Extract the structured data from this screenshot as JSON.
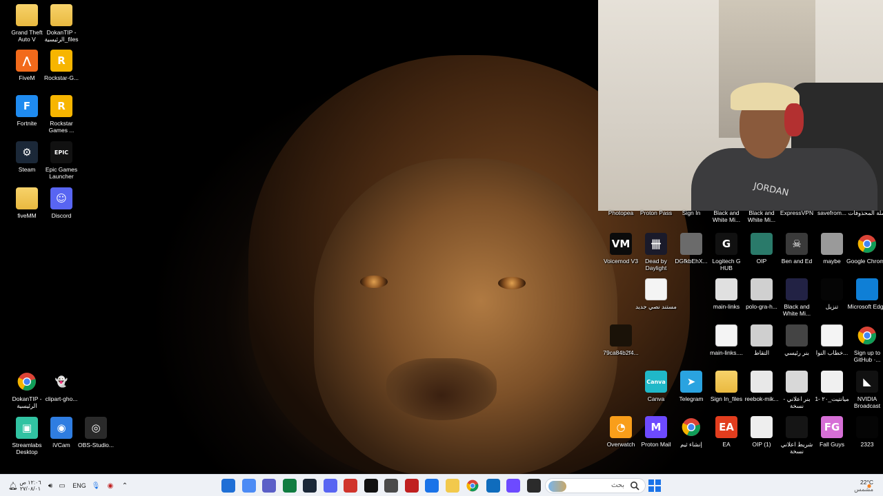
{
  "desktop_left_icons": [
    {
      "label": "Grand Theft Auto V",
      "icon": "folder-icon",
      "color": "#f2c94c"
    },
    {
      "label": "DokanTIP - الرئيسية_files",
      "icon": "folder-icon",
      "color": "#f2c94c"
    },
    {
      "label": "FiveM",
      "icon": "fivem-icon",
      "color": "#f26a1b",
      "glyph": "⋀"
    },
    {
      "label": "Rockstar-G...",
      "icon": "rockstar-icon",
      "color": "#f7b500",
      "glyph": "R"
    },
    {
      "label": "Fortnite",
      "icon": "fortnite-icon",
      "color": "#1f8bf0",
      "glyph": "F"
    },
    {
      "label": "Rockstar Games ...",
      "icon": "rockstar-icon",
      "color": "#f7b500",
      "glyph": "R"
    },
    {
      "label": "Steam",
      "icon": "steam-icon",
      "color": "#1b2838",
      "glyph": "⚙"
    },
    {
      "label": "Epic Games Launcher",
      "icon": "epic-games-icon",
      "color": "#111111",
      "glyph": "EPIC"
    },
    {
      "label": "fiveMM",
      "icon": "folder-icon",
      "color": "#f2c94c"
    },
    {
      "label": "Discord",
      "icon": "discord-icon",
      "color": "#5865f2",
      "glyph": "☺"
    },
    {
      "label": "DokanTIP - الرئيسية",
      "icon": "chrome-icon",
      "color": "#ffffff"
    },
    {
      "label": "clipart-gho...",
      "icon": "ghost-icon",
      "color": "#000000",
      "glyph": "👻"
    },
    {
      "label": "Streamlabs Desktop",
      "icon": "streamlabs-icon",
      "color": "#31c3a2",
      "glyph": "▣"
    },
    {
      "label": "iVCam",
      "icon": "ivcam-icon",
      "color": "#2f7de1",
      "glyph": "◉"
    },
    {
      "label": "OBS-Studio...",
      "icon": "obs-icon",
      "color": "#2a2a2a",
      "glyph": "◎"
    }
  ],
  "desktop_right_top_row": [
    {
      "label": "Photopea"
    },
    {
      "label": "Proton Pass"
    },
    {
      "label": "Sign In"
    },
    {
      "label": "Black and White Mi..."
    },
    {
      "label": "Black and White Mi..."
    },
    {
      "label": "ExpressVPN"
    },
    {
      "label": "savefrom..."
    },
    {
      "label": "سلة المحذوفات"
    }
  ],
  "desktop_right_icons": [
    {
      "label": "Voicemod V3",
      "icon": "voicemod-icon",
      "color": "#0b0b0b",
      "glyph": "VM"
    },
    {
      "label": "Dead by Daylight",
      "icon": "dead-by-daylight-icon",
      "color": "#1a1a2a",
      "glyph": "卌"
    },
    {
      "label": "DGfkbEhX...",
      "icon": "image-icon",
      "color": "#6b6b6b"
    },
    {
      "label": "Logitech G HUB",
      "icon": "logitech-icon",
      "color": "#111111",
      "glyph": "G"
    },
    {
      "label": "OIP",
      "icon": "image-icon",
      "color": "#2a7a6a"
    },
    {
      "label": "Ben and Ed",
      "icon": "ben-and-ed-icon",
      "color": "#3a3a3a",
      "glyph": "☠"
    },
    {
      "label": "maybe",
      "icon": "image-icon",
      "color": "#9a9a9a"
    },
    {
      "label": "Google Chrome",
      "icon": "chrome-icon",
      "color": "#ffffff"
    },
    {
      "label": "مستند نصي جديد",
      "icon": "text-document-icon",
      "color": "#ffffff"
    },
    {
      "label": "main-links",
      "icon": "image-icon",
      "color": "#e0e0e0"
    },
    {
      "label": "polo-gra-h...",
      "icon": "image-icon",
      "color": "#d0d0d0"
    },
    {
      "label": "Black and White Mi...",
      "icon": "image-icon",
      "color": "#222244"
    },
    {
      "label": "تنزيل",
      "icon": "image-icon",
      "color": "#050505"
    },
    {
      "label": "Microsoft Edge",
      "icon": "edge-icon",
      "color": "#0f7fd6"
    },
    {
      "label": "79ca84b2f4...",
      "icon": "image-icon",
      "color": "#1a1208"
    },
    {
      "label": "main-links....",
      "icon": "text-document-icon",
      "color": "#ffffff"
    },
    {
      "label": "التقاط",
      "icon": "image-icon",
      "color": "#cfcfcf"
    },
    {
      "label": "بنر رئيسي",
      "icon": "image-icon",
      "color": "#444444"
    },
    {
      "label": "خطاب النوا...",
      "icon": "text-document-icon",
      "color": "#ffffff"
    },
    {
      "label": "Sign up to GitHub ·...",
      "icon": "chrome-icon",
      "color": "#ffffff"
    },
    {
      "label": "Canva",
      "icon": "canva-icon",
      "color": "#20b8c8",
      "glyph": "Canva"
    },
    {
      "label": "Telegram",
      "icon": "telegram-icon",
      "color": "#2aa3e0",
      "glyph": "➤"
    },
    {
      "label": "Sign In_files",
      "icon": "folder-icon",
      "color": "#f2c94c"
    },
    {
      "label": "reebok-mik...",
      "icon": "image-icon",
      "color": "#e8e8e8"
    },
    {
      "label": "بنر اعلاني - نسخة",
      "icon": "image-icon",
      "color": "#d8d8d8"
    },
    {
      "label": "ميانتيت_٢٠ -1",
      "icon": "image-icon",
      "color": "#f0f0f0"
    },
    {
      "label": "NVIDIA Broadcast",
      "icon": "nvidia-icon",
      "color": "#111111",
      "glyph": "◣"
    },
    {
      "label": "Overwatch",
      "icon": "overwatch-icon",
      "color": "#f99e1a",
      "glyph": "◔"
    },
    {
      "label": "Proton Mail",
      "icon": "proton-mail-icon",
      "color": "#6d4aff",
      "glyph": "M"
    },
    {
      "label": "إنشاء ثيم",
      "icon": "chrome-icon",
      "color": "#ffffff"
    },
    {
      "label": "EA",
      "icon": "ea-icon",
      "color": "#e23d1e",
      "glyph": "EA"
    },
    {
      "label": "OIP (1)",
      "icon": "image-icon",
      "color": "#eeeeee"
    },
    {
      "label": "شريط اعلاني نسخة",
      "icon": "image-icon",
      "color": "#151515"
    },
    {
      "label": "Fall Guys",
      "icon": "fall-guys-icon",
      "color": "#d66fd6",
      "glyph": "FG"
    },
    {
      "label": "2323",
      "icon": "image-icon",
      "color": "#050505"
    }
  ],
  "webcam": {
    "shirt_text": "JORDAN"
  },
  "taskbar": {
    "time": "١٢:٠٦ ص",
    "date": "٢٧/٠٨/٠١",
    "language": "ENG",
    "search_placeholder": "بحث",
    "weather_temp": "22°C",
    "weather_desc": "مشمس",
    "apps": [
      {
        "name": "snipping-tool-icon",
        "color": "#1f6fd6"
      },
      {
        "name": "person-app-icon",
        "color": "#4c8bf5"
      },
      {
        "name": "teams-icon",
        "color": "#5b5fc7"
      },
      {
        "name": "excel-icon",
        "color": "#107c41"
      },
      {
        "name": "steam-icon",
        "color": "#1b2838"
      },
      {
        "name": "discord-icon",
        "color": "#5865f2"
      },
      {
        "name": "headset-icon",
        "color": "#d0342c"
      },
      {
        "name": "epic-games-icon",
        "color": "#111111"
      },
      {
        "name": "cube-icon",
        "color": "#4a4a4a"
      },
      {
        "name": "record-icon",
        "color": "#c02020"
      },
      {
        "name": "store-icon",
        "color": "#1a73e8"
      },
      {
        "name": "file-explorer-icon",
        "color": "#f2c94c"
      },
      {
        "name": "chrome-icon",
        "color": "#ffffff"
      },
      {
        "name": "outlook-icon",
        "color": "#0f6cbd"
      },
      {
        "name": "proton-icon",
        "color": "#6d4aff"
      },
      {
        "name": "terminal-icon",
        "color": "#2b2b2b"
      }
    ]
  }
}
